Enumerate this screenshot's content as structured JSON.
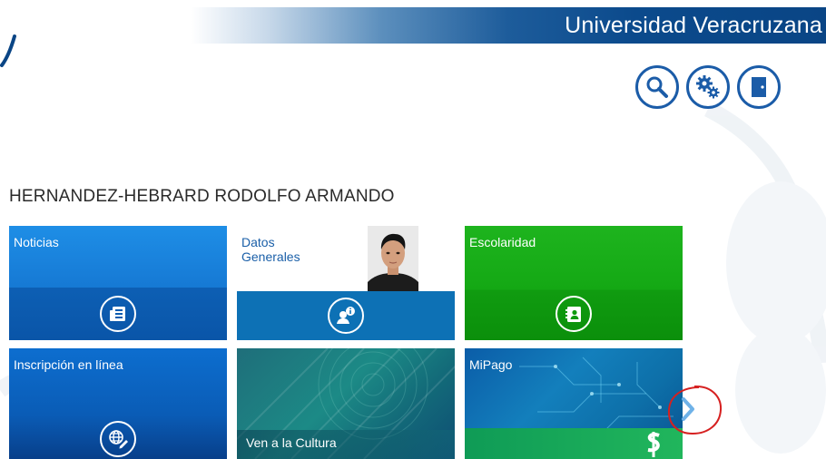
{
  "header": {
    "title": "Universidad Veracruzana"
  },
  "toolbar": {
    "buttons": [
      {
        "name": "search-icon"
      },
      {
        "name": "gear-icon"
      },
      {
        "name": "door-icon"
      }
    ]
  },
  "student": {
    "name": "HERNANDEZ-HEBRARD RODOLFO ARMANDO"
  },
  "tiles": {
    "noticias": {
      "label": "Noticias",
      "icon": "newspaper-icon",
      "color": "#1679d4"
    },
    "datos": {
      "label_line1": "Datos",
      "label_line2": "Generales",
      "icon": "user-info-icon",
      "color": "#0d71b5"
    },
    "escolaridad": {
      "label": "Escolaridad",
      "icon": "address-book-icon",
      "color": "#14a814"
    },
    "inscripcion": {
      "label": "Inscripción en línea",
      "icon": "globe-pen-icon",
      "color": "#0a5cb6"
    },
    "cultura": {
      "label": "Ven a la Cultura",
      "color": "#1c8a86"
    },
    "mipago": {
      "label": "MiPago",
      "color": "#137fbc"
    }
  },
  "navigation": {
    "next_icon": "chevron-right-icon"
  },
  "colors": {
    "brand_blue": "#0a4585",
    "icon_blue": "#1b5ca8",
    "highlight_red": "#d62020"
  }
}
